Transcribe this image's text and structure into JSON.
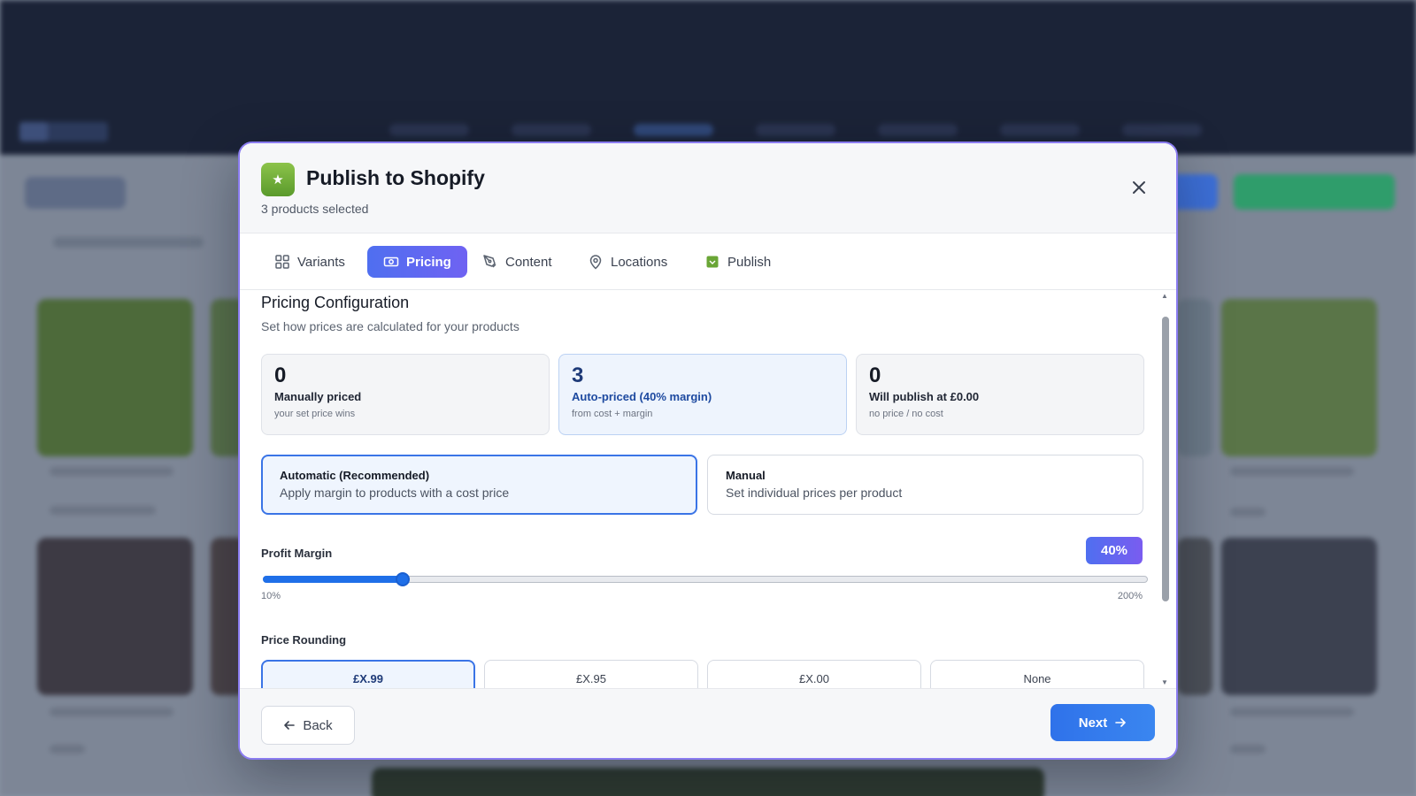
{
  "modal": {
    "title": "Publish to Shopify",
    "subtitle": "3 products selected",
    "icon": "shopify-bag-icon"
  },
  "tabs": [
    {
      "label": "Variants",
      "icon": "grid-icon",
      "active": false
    },
    {
      "label": "Pricing",
      "icon": "banknote-icon",
      "active": true
    },
    {
      "label": "Content",
      "icon": "pen-tool-icon",
      "active": false
    },
    {
      "label": "Locations",
      "icon": "map-pin-icon",
      "active": false
    },
    {
      "label": "Publish",
      "icon": "shopify-bag-icon",
      "active": false
    }
  ],
  "pricing": {
    "title": "Pricing Configuration",
    "description": "Set how prices are calculated for your products",
    "stats": [
      {
        "value": "0",
        "label": "Manually priced",
        "hint": "your set price wins"
      },
      {
        "value": "3",
        "label": "Auto-priced (40% margin)",
        "hint": "from cost + margin"
      },
      {
        "value": "0",
        "label": "Will publish at £0.00",
        "hint": "no price / no cost"
      }
    ],
    "modes": [
      {
        "title": "Automatic (Recommended)",
        "description": "Apply margin to products with a cost price",
        "selected": true
      },
      {
        "title": "Manual",
        "description": "Set individual prices per product",
        "selected": false
      }
    ],
    "margin": {
      "label": "Profit Margin",
      "display": "40%",
      "value": 40,
      "min": 10,
      "max": 200,
      "min_label": "10%",
      "max_label": "200%"
    },
    "rounding": {
      "label": "Price Rounding",
      "options": [
        "£X.99",
        "£X.95",
        "£X.00",
        "None"
      ],
      "selected": "£X.99"
    }
  },
  "footer": {
    "back_label": "Back",
    "next_label": "Next"
  },
  "colors": {
    "accent": "#1f6fe8",
    "tab_active_start": "#4f6ff0",
    "tab_active_end": "#6f62f2",
    "shopify_green": "#6aa636",
    "modal_border": "#8a7cf0"
  }
}
